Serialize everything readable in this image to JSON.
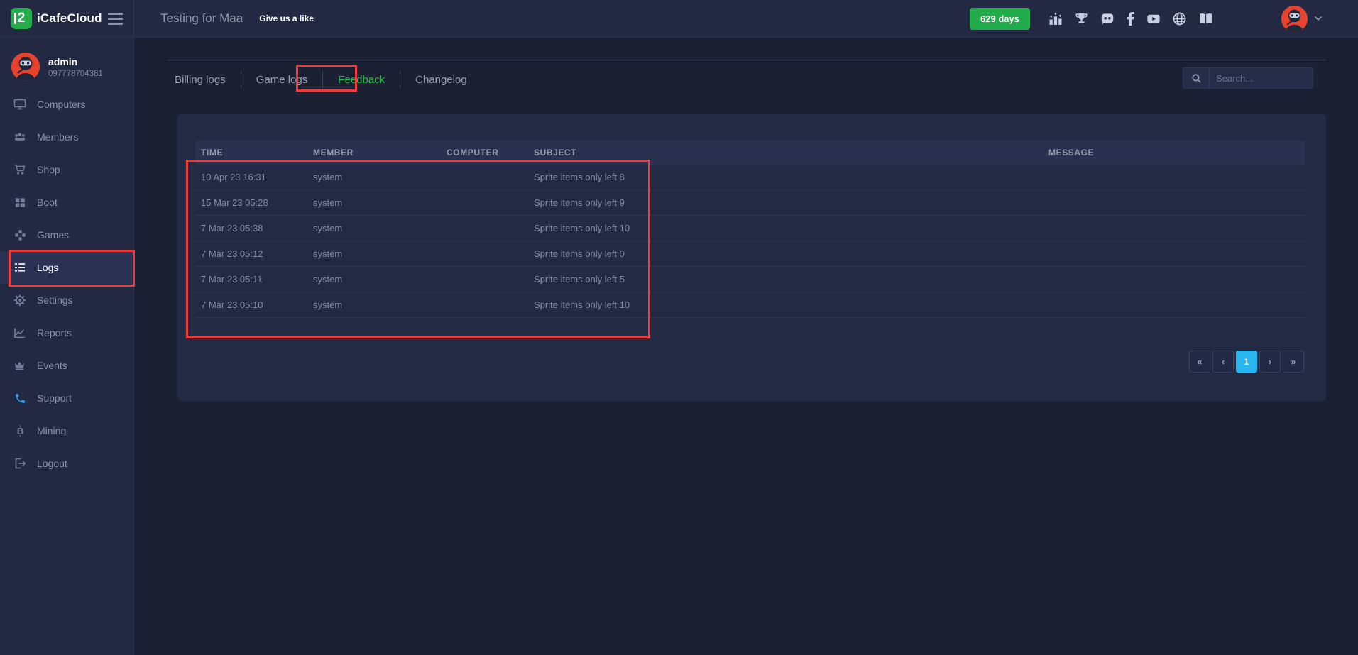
{
  "topbar": {
    "logo_glyph": "2",
    "brand": "iCafeCloud",
    "title": "Testing for Maa",
    "like_text": "Give us a like",
    "days_badge": "629 days",
    "icons": [
      "ranking-icon",
      "trophy-icon",
      "discord-icon",
      "facebook-icon",
      "youtube-icon",
      "globe-icon",
      "book-icon"
    ]
  },
  "sidebar": {
    "user": {
      "name": "admin",
      "phone": "097778704381"
    },
    "items": [
      {
        "label": "Computers",
        "icon": "monitor-icon"
      },
      {
        "label": "Members",
        "icon": "members-icon"
      },
      {
        "label": "Shop",
        "icon": "cart-icon"
      },
      {
        "label": "Boot",
        "icon": "windows-icon"
      },
      {
        "label": "Games",
        "icon": "gamepad-icon"
      },
      {
        "label": "Logs",
        "icon": "list-icon",
        "active": true
      },
      {
        "label": "Settings",
        "icon": "gear-icon"
      },
      {
        "label": "Reports",
        "icon": "line-chart-icon"
      },
      {
        "label": "Events",
        "icon": "crown-icon"
      },
      {
        "label": "Support",
        "icon": "phone-icon"
      },
      {
        "label": "Mining",
        "icon": "bitcoin-icon"
      },
      {
        "label": "Logout",
        "icon": "logout-icon"
      }
    ]
  },
  "tabs": [
    {
      "label": "Billing logs"
    },
    {
      "label": "Game logs"
    },
    {
      "label": "Feedback",
      "active": true
    },
    {
      "label": "Changelog"
    }
  ],
  "search": {
    "placeholder": "Search..."
  },
  "table": {
    "columns": [
      "TIME",
      "MEMBER",
      "COMPUTER",
      "SUBJECT",
      "MESSAGE"
    ],
    "rows": [
      {
        "time": "10 Apr 23 16:31",
        "member": "system",
        "computer": "",
        "subject": "Sprite items only left 8",
        "message": ""
      },
      {
        "time": "15 Mar 23 05:28",
        "member": "system",
        "computer": "",
        "subject": "Sprite items only left 9",
        "message": ""
      },
      {
        "time": "7 Mar 23 05:38",
        "member": "system",
        "computer": "",
        "subject": "Sprite items only left 10",
        "message": ""
      },
      {
        "time": "7 Mar 23 05:12",
        "member": "system",
        "computer": "",
        "subject": "Sprite items only left 0",
        "message": ""
      },
      {
        "time": "7 Mar 23 05:11",
        "member": "system",
        "computer": "",
        "subject": "Sprite items only left 5",
        "message": ""
      },
      {
        "time": "7 Mar 23 05:10",
        "member": "system",
        "computer": "",
        "subject": "Sprite items only left 10",
        "message": ""
      }
    ]
  },
  "pagination": {
    "first": "«",
    "prev": "‹",
    "page1": "1",
    "next": "›",
    "last": "»",
    "active_page": "1"
  },
  "colors": {
    "brand_green": "#23ad4b",
    "badge_green": "#22ab4b",
    "feedback_tab_green": "#2dbd4e",
    "active_page_blue": "#29b5ef",
    "annotation_red": "#f23b3b",
    "avatar_red": "#e8432d",
    "support_blue": "#2e9ae4",
    "sidebar_bg": "#232942",
    "page_bg": "#1b2033",
    "panel_bg": "#232a44"
  }
}
